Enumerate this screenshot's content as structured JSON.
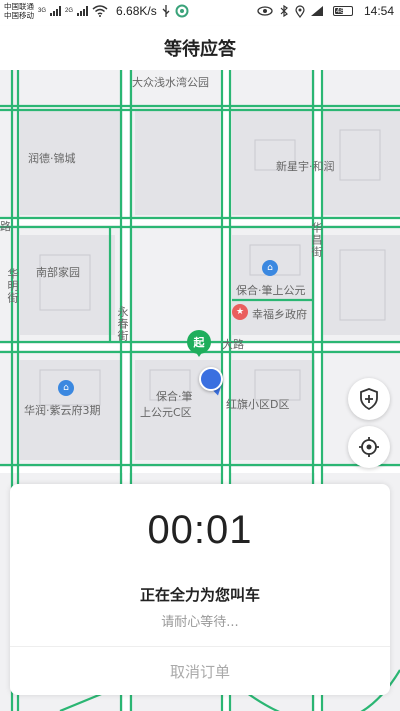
{
  "status_bar": {
    "carrier_1": "中国联通",
    "carrier_2": "中国移动",
    "net_1": "3G",
    "net_2": "2G",
    "speed": "6.68K/s",
    "battery_label": "48",
    "time": "14:54"
  },
  "header": {
    "title": "等待应答"
  },
  "map": {
    "labels": {
      "park": "大众浅水湾公园",
      "runde": "润德·锦城",
      "xinxingyu": "新星宇·和润",
      "road_left": "路",
      "huachang": "华昌街",
      "nanbu": "南部家园",
      "huaming": "华明街",
      "baohe_north": "保合·筆上公元",
      "government": "幸福乡政府",
      "yongchun": "永春街",
      "dalu": "大路",
      "ziyunfu": "华润·紫云府3期",
      "baohe_c_1": "保合·筆",
      "baohe_c_2": "上公元C区",
      "hongqi": "红旗小区D区"
    },
    "start_marker": "起",
    "colors": {
      "road": "#2bb673",
      "route_marker": "#1fae5c",
      "location": "#3a6fe0",
      "poi_blue": "#3b88e0",
      "poi_red": "#ea5e5e"
    }
  },
  "card": {
    "timer": "00:01",
    "status": "正在全力为您叫车",
    "hint": "请耐心等待...",
    "cancel_label": "取消订单"
  }
}
